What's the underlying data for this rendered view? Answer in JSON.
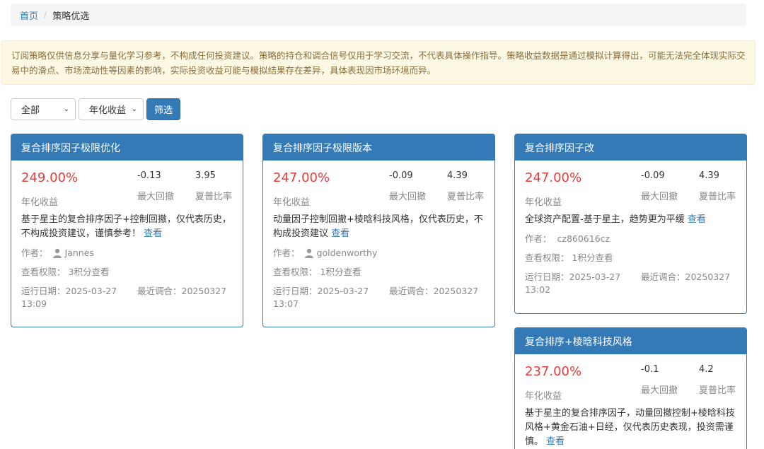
{
  "breadcrumb": {
    "home": "首页",
    "separator": "/",
    "current": "策略优选"
  },
  "notice": "订阅策略仅供信息分享与量化学习参考，不构成任何投资建议。策略的持仓和调合信号仅用于学习交流，不代表具体操作指导。策略收益数据是通过模拟计算得出，可能无法完全体现实际交易中的滑点、市场流动性等因素的影响，实际投资收益可能与模拟结果存在差异，具体表现因市场环境而异。",
  "filters": {
    "category": "全部",
    "sort": "年化收益",
    "button": "筛选"
  },
  "labels": {
    "annual_return": "年化收益",
    "max_drawdown": "最大回撤",
    "sharpe": "夏普比率",
    "author": "作者：",
    "permission": "查看权限：",
    "run_date": "运行日期：",
    "recent_rebalance": "最近调合：",
    "view": "查看"
  },
  "cards": [
    {
      "title": "复合排序因子极限优化",
      "annual_return": "249.00%",
      "max_drawdown": "-0.13",
      "sharpe": "3.95",
      "desc": "基于星主的复合排序因子+控制回撤，仅代表历史，不构成投资建议，谨慎参考！",
      "author": "Jannes",
      "permission": "3积分查看",
      "run_date": "2025-03-27 13:09",
      "recent": "20250327"
    },
    {
      "title": "复合排序因子极限版本",
      "annual_return": "247.00%",
      "max_drawdown": "-0.09",
      "sharpe": "4.39",
      "desc": "动量因子控制回撤+棱晗科技风格，仅代表历史，不构成投资建议",
      "author": "goldenworthy",
      "permission": "1积分查看",
      "run_date": "2025-03-27 13:07",
      "recent": "20250327"
    },
    {
      "title": "复合排序因子改",
      "annual_return": "247.00%",
      "max_drawdown": "-0.09",
      "sharpe": "4.39",
      "desc": "全球资产配置-基于星主，趋势更为平缓",
      "author": "cz860616cz",
      "permission": "1积分查看",
      "run_date": "2025-03-27 13:02",
      "recent": "20250327"
    },
    {
      "title": "复合排序+棱晗科技风格",
      "annual_return": "237.00%",
      "max_drawdown": "-0.1",
      "sharpe": "4.2",
      "desc": "基于星主的复合排序因子，动量回撤控制+棱晗科技风格+黄金石油+日经，仅代表历史表现，投资需谨慎。"
    }
  ]
}
